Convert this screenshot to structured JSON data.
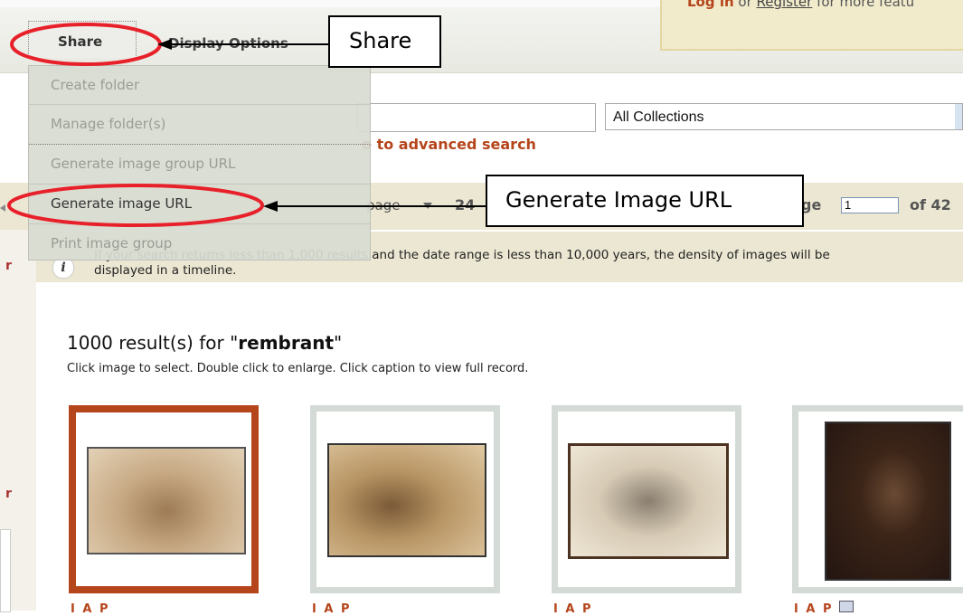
{
  "login": {
    "login_link": "Log in",
    "or_text": " or ",
    "register_link": "Register",
    "rest": " for more featu"
  },
  "menubar": {
    "share": "Share",
    "display_options": "Display Options"
  },
  "share_menu": {
    "items": [
      {
        "label": "Create folder",
        "enabled": false
      },
      {
        "label": "Manage folder(s)",
        "enabled": false
      },
      {
        "label": "Generate image group URL",
        "enabled": false
      },
      {
        "label": "Generate image URL",
        "enabled": true
      },
      {
        "label": "Print image group",
        "enabled": false
      }
    ]
  },
  "search": {
    "value": "",
    "collections_value": "All Collections",
    "advanced_link": "o to advanced search"
  },
  "pager": {
    "per_page_label": "page",
    "per_page_value": "24",
    "page_label": "ge",
    "page_value": "1",
    "page_total": "of 42"
  },
  "info": {
    "text": "If your search returns less than 1,000 results and the date range is less than 10,000 years, the density of images will be displayed in a timeline."
  },
  "results": {
    "count_prefix": "1000 result(s) for \"",
    "query": "rembrant",
    "count_suffix": "\"",
    "instructions": "Click image to select. Double click to enlarge. Click caption to view full record.",
    "items": [
      {
        "caption": "I A P",
        "selected": true
      },
      {
        "caption": "I A P",
        "selected": false
      },
      {
        "caption": "I A P",
        "selected": false
      },
      {
        "caption": "I A P",
        "selected": false
      }
    ]
  },
  "callouts": {
    "share": "Share",
    "generate_url": "Generate Image URL"
  },
  "colors": {
    "accent": "#b5451b",
    "annotation_red": "#e8202a",
    "band": "#ece7d2"
  }
}
